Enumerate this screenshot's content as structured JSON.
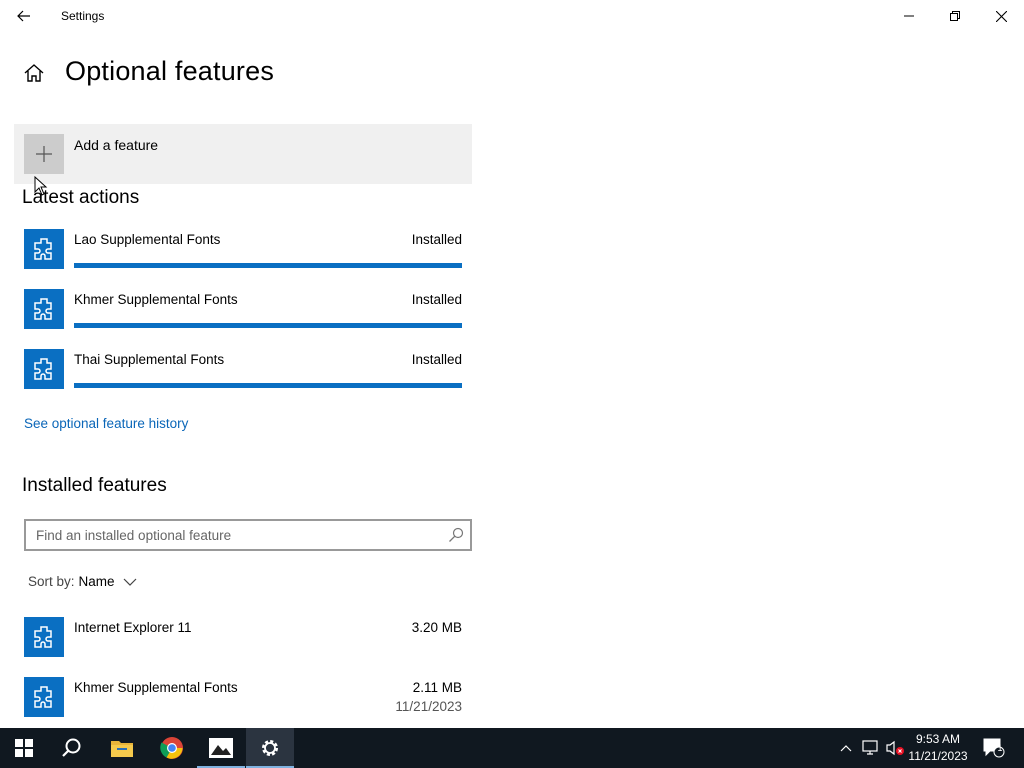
{
  "window": {
    "title": "Settings"
  },
  "header": {
    "page_title": "Optional features"
  },
  "add_feature": {
    "label": "Add a feature"
  },
  "latest_actions": {
    "heading": "Latest actions",
    "items": [
      {
        "name": "Lao Supplemental Fonts",
        "status": "Installed",
        "progress": 1.0
      },
      {
        "name": "Khmer Supplemental Fonts",
        "status": "Installed",
        "progress": 1.0
      },
      {
        "name": "Thai Supplemental Fonts",
        "status": "Installed",
        "progress": 1.0
      }
    ]
  },
  "history_link": "See optional feature history",
  "installed": {
    "heading": "Installed features",
    "search_placeholder": "Find an installed optional feature",
    "sort_label": "Sort by:",
    "sort_value": "Name",
    "items": [
      {
        "name": "Internet Explorer 11",
        "size": "3.20 MB",
        "date": ""
      },
      {
        "name": "Khmer Supplemental Fonts",
        "size": "2.11 MB",
        "date": "11/21/2023"
      }
    ]
  },
  "taskbar": {
    "time": "9:53 AM",
    "date": "11/21/2023",
    "notification_count": "1"
  },
  "colors": {
    "accent": "#0a6fc2",
    "link": "#0a66b8",
    "taskbar": "#101820"
  }
}
